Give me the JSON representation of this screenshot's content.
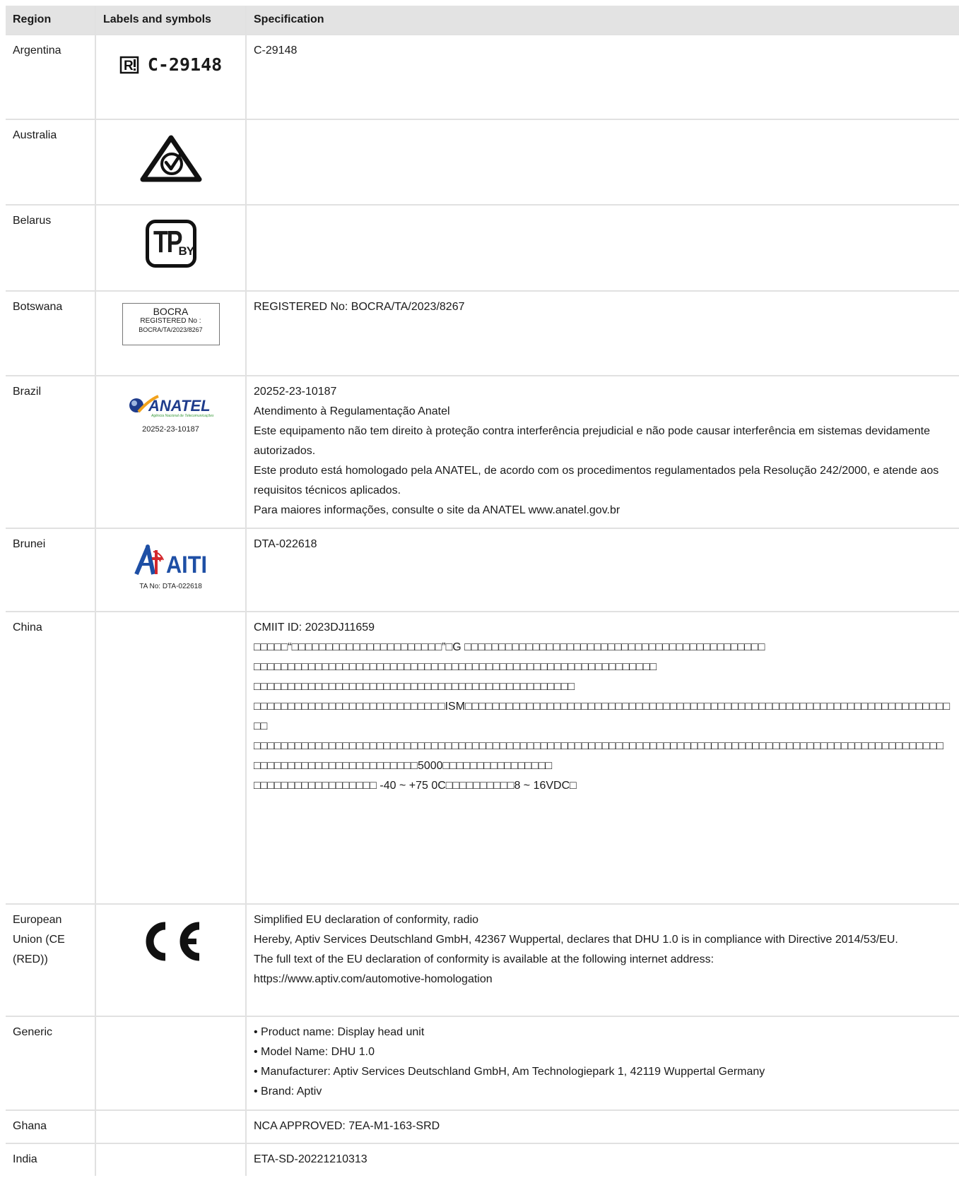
{
  "header": {
    "region": "Region",
    "labels": "Labels and symbols",
    "spec": "Specification"
  },
  "rows": {
    "argentina": {
      "region": "Argentina",
      "mark_text": "C-29148",
      "spec": [
        "C-29148"
      ]
    },
    "australia": {
      "region": "Australia"
    },
    "belarus": {
      "region": "Belarus"
    },
    "botswana": {
      "region": "Botswana",
      "mark": [
        "BOCRA",
        "REGISTERED No :",
        "BOCRA/TA/2023/8267"
      ],
      "spec": [
        "REGISTERED No: BOCRA/TA/2023/8267"
      ]
    },
    "brazil": {
      "region": "Brazil",
      "mark_number": "20252-23-10187",
      "spec": [
        "20252-23-10187",
        "Atendimento à Regulamentação Anatel",
        "Este equipamento não tem direito à proteção contra interferência prejudicial e não pode causar interferência em sistemas devidamente autorizados.",
        "Este produto está homologado pela ANATEL, de acordo com os procedimentos regulamentados pela Resolução 242/2000, e atende aos requisitos técnicos aplicados.",
        "Para maiores informações, consulte o site da ANATEL www.anatel.gov.br"
      ]
    },
    "brunei": {
      "region": "Brunei",
      "mark_number": "TA No: DTA-022618",
      "spec": [
        "DTA-022618"
      ]
    },
    "china": {
      "region": "China",
      "spec": [
        "CMIIT ID: 2023DJ11659",
        "□□□□□“□□□□□□□□□□□□□□□□□□□□□□”□G □□□□□□□□□□□□□□□□□□□□□□□□□□□□□□□□□□□□□□□□□□□□",
        "□□□□□□□□□□□□□□□□□□□□□□□□□□□□□□□□□□□□□□□□□□□□□□□□□□□□□□□□□□□",
        "□□□□□□□□□□□□□□□□□□□□□□□□□□□□□□□□□□□□□□□□□□□□□□□",
        "□□□□□□□□□□□□□□□□□□□□□□□□□□□□ISM□□□□□□□□□□□□□□□□□□□□□□□□□□□□□□□□□□□□□□□□□□□□□□□□□□□□□□□□□□□□□□□□□□□□□□□□□",
        "□□□□□□□□□□□□□□□□□□□□□□□□□□□□□□□□□□□□□□□□□□□□□□□□□□□□□□□□□□□□□□□□□□□□□□□□□□□□□□□□□□□□□□□□□□□□□□□□□□□□□",
        "□□□□□□□□□□□□□□□□□□□□□□□□5000□□□□□□□□□□□□□□□□",
        "□□□□□□□□□□□□□□□□□□ -40 ~ +75 0C□□□□□□□□□□8 ~ 16VDC□"
      ]
    },
    "eu": {
      "region": "European Union (CE (RED))",
      "spec": [
        "Simplified EU declaration of conformity, radio",
        "Hereby, Aptiv Services Deutschland GmbH, 42367 Wuppertal, declares that DHU 1.0 is in compliance with Directive 2014/53/EU.",
        "The full text of the EU declaration of conformity is available at the following internet address:",
        "https://www.aptiv.com/automotive-homologation"
      ]
    },
    "generic": {
      "region": "Generic",
      "spec": [
        "• Product name: Display head unit",
        "• Model Name: DHU 1.0",
        "• Manufacturer: Aptiv Services Deutschland GmbH, Am Technologiepark 1, 42119 Wuppertal Germany",
        "• Brand: Aptiv"
      ]
    },
    "ghana": {
      "region": "Ghana",
      "spec": [
        "NCA APPROVED: 7EA-M1-163-SRD"
      ]
    },
    "india": {
      "region": "India",
      "spec": [
        "ETA-SD-20221210313"
      ]
    }
  },
  "logos": {
    "anatel": "ANATEL",
    "anatel_sub": "Agência Nacional de Telecomunicações",
    "aiti": "AITI",
    "belarus": "TP",
    "belarus_sub": "BY"
  },
  "colors": {
    "header_bg": "#e3e3e3",
    "grid": "#e1e1e1",
    "anatel_blue": "#1f3c8c",
    "anatel_orange": "#f2a21b",
    "anatel_green": "#3c9b3c",
    "aiti_blue": "#1e4fa5",
    "aiti_red": "#d3272c"
  }
}
